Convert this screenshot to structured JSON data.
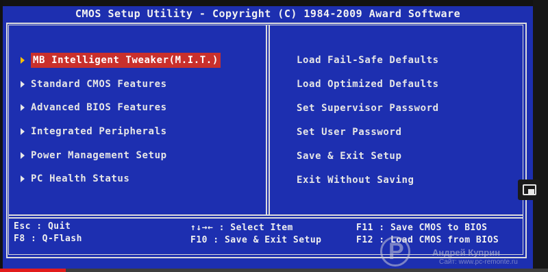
{
  "bios": {
    "title": "CMOS Setup Utility - Copyright (C) 1984-2009 Award Software",
    "left_menu": [
      {
        "label": "MB Intelligent Tweaker(M.I.T.)",
        "selected": true
      },
      {
        "label": "Standard CMOS Features"
      },
      {
        "label": "Advanced BIOS Features"
      },
      {
        "label": "Integrated Peripherals"
      },
      {
        "label": "Power Management Setup"
      },
      {
        "label": "PC Health Status"
      }
    ],
    "right_menu": [
      {
        "label": "Load Fail-Safe Defaults"
      },
      {
        "label": "Load Optimized Defaults"
      },
      {
        "label": "Set Supervisor Password"
      },
      {
        "label": "Set User Password"
      },
      {
        "label": "Save & Exit Setup"
      },
      {
        "label": "Exit Without Saving"
      }
    ],
    "help": {
      "esc": "Esc  : Quit",
      "f8": "F8   : Q-Flash",
      "arrows": "↑↓→← : Select Item",
      "f10": "F10  : Save & Exit Setup",
      "f11": "F11  : Save CMOS to BIOS",
      "f12": "F12  : Load CMOS from BIOS"
    }
  },
  "watermark": {
    "name": "Андрей Куприн",
    "site": "Сайт: www.pc-remonte.ru"
  },
  "colors": {
    "background": "#1d2fb0",
    "text": "#e6e6e6",
    "selection": "#c9302c",
    "frame": "#dcdcdc"
  },
  "video": {
    "played_fraction": 0.12
  }
}
